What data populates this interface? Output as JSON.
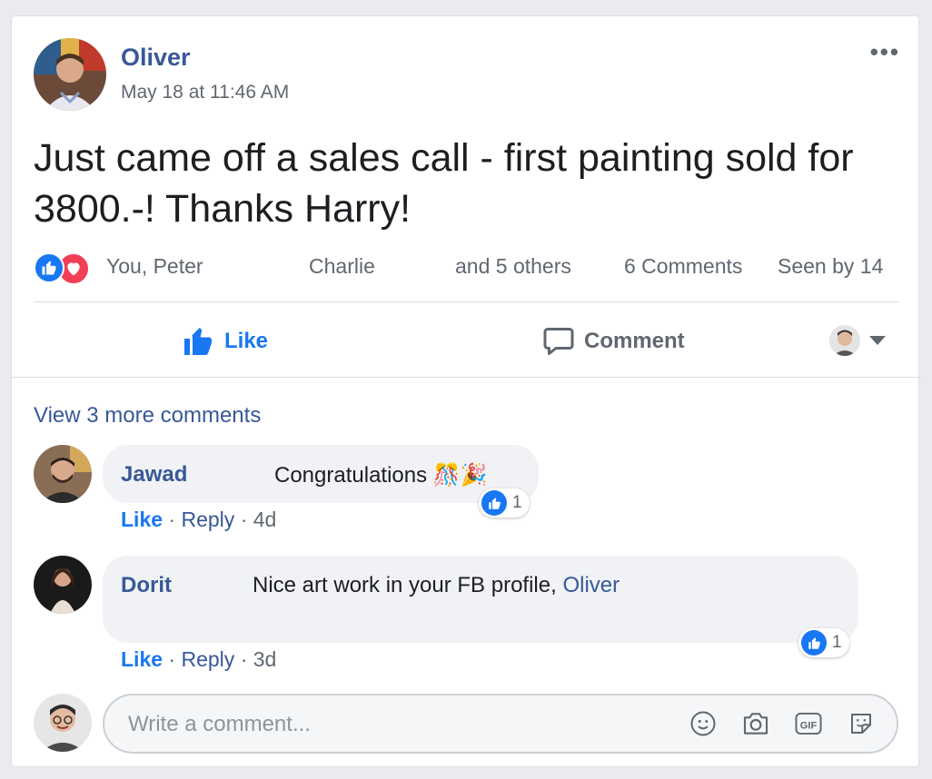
{
  "post": {
    "author": "Oliver",
    "timestamp": "May 18 at 11:46 AM",
    "text": "Just came off a sales call - first painting sold for 3800.-! Thanks Harry!",
    "more_label": "•••"
  },
  "reactions": {
    "names_1": "You, Peter",
    "names_2": "Charlie",
    "names_3": "and 5 others",
    "comments_count": "6 Comments",
    "seen_by": "Seen by 14"
  },
  "actions": {
    "like": "Like",
    "comment": "Comment"
  },
  "comments": {
    "view_more": "View 3 more comments",
    "items": [
      {
        "name": "Jawad",
        "text": "Congratulations 🎊🎉",
        "like": "Like",
        "sep1": "·",
        "reply": "Reply",
        "sep2": "·",
        "age": "4d",
        "reaction_count": "1"
      },
      {
        "name": "Dorit",
        "text": "Nice art work in your FB profile, ",
        "mention": "Oliver",
        "like": "Like",
        "sep1": "·",
        "reply": "Reply",
        "sep2": "·",
        "age": "3d",
        "reaction_count": "1"
      }
    ]
  },
  "composer": {
    "placeholder": "Write a comment..."
  },
  "colors": {
    "link": "#385898",
    "like_blue": "#1877f2",
    "love_red": "#f33e58",
    "secondary_text": "#606770"
  }
}
